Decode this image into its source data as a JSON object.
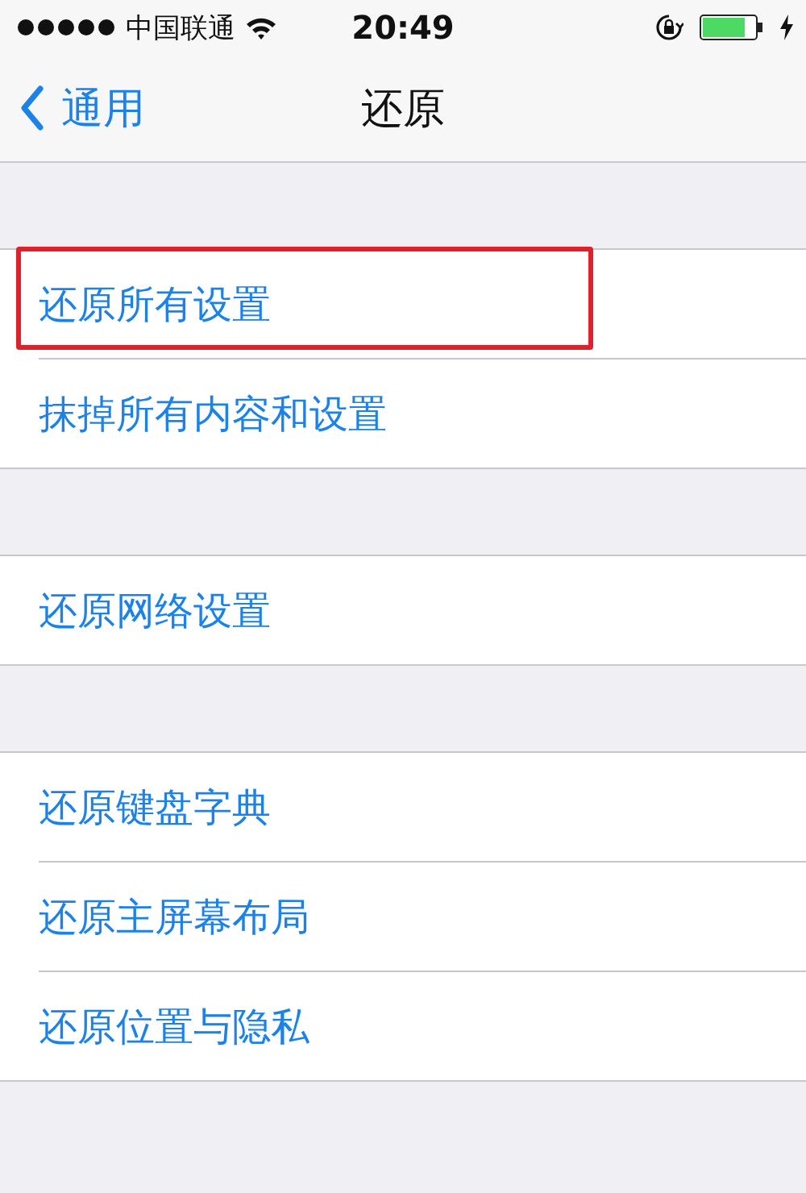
{
  "status_bar": {
    "carrier": "中国联通",
    "time": "20:49"
  },
  "nav_bar": {
    "back": "通用",
    "title": "还原"
  },
  "groups": [
    {
      "rows": [
        {
          "label": "还原所有设置",
          "highlighted": true
        },
        {
          "label": "抹掉所有内容和设置",
          "highlighted": false
        }
      ]
    },
    {
      "rows": [
        {
          "label": "还原网络设置",
          "highlighted": false
        }
      ]
    },
    {
      "rows": [
        {
          "label": "还原键盘字典",
          "highlighted": false
        },
        {
          "label": "还原主屏幕布局",
          "highlighted": false
        },
        {
          "label": "还原位置与隐私",
          "highlighted": false
        }
      ]
    }
  ]
}
